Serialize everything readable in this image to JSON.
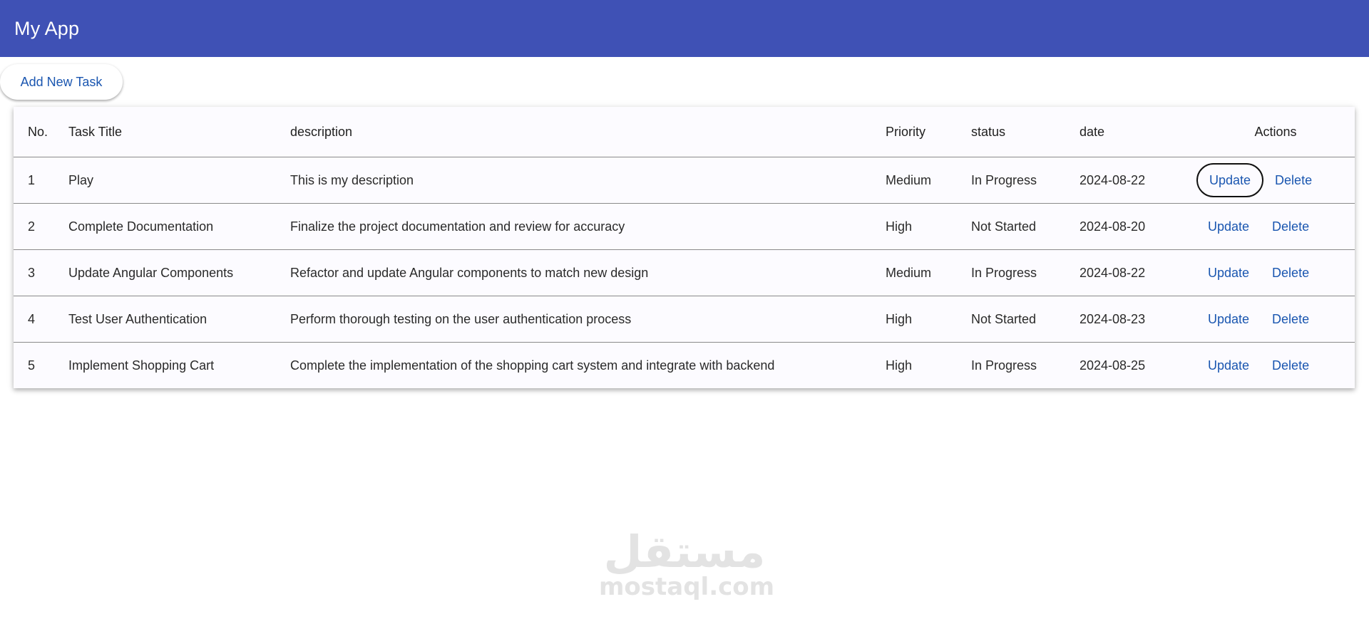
{
  "app": {
    "title": "My App"
  },
  "toolbar": {
    "add_label": "Add New Task"
  },
  "table": {
    "headers": {
      "no": "No.",
      "title": "Task Title",
      "description": "description",
      "priority": "Priority",
      "status": "status",
      "date": "date",
      "actions": "Actions"
    },
    "rows": [
      {
        "no": "1",
        "title": "Play",
        "description": "This is my description",
        "priority": "Medium",
        "status": "In Progress",
        "date": "2024-08-22",
        "update": "Update",
        "delete": "Delete"
      },
      {
        "no": "2",
        "title": "Complete Documentation",
        "description": "Finalize the project documentation and review for accuracy",
        "priority": "High",
        "status": "Not Started",
        "date": "2024-08-20",
        "update": "Update",
        "delete": "Delete"
      },
      {
        "no": "3",
        "title": "Update Angular Components",
        "description": "Refactor and update Angular components to match new design",
        "priority": "Medium",
        "status": "In Progress",
        "date": "2024-08-22",
        "update": "Update",
        "delete": "Delete"
      },
      {
        "no": "4",
        "title": "Test User Authentication",
        "description": "Perform thorough testing on the user authentication process",
        "priority": "High",
        "status": "Not Started",
        "date": "2024-08-23",
        "update": "Update",
        "delete": "Delete"
      },
      {
        "no": "5",
        "title": "Implement Shopping Cart",
        "description": "Complete the implementation of the shopping cart system and integrate with backend",
        "priority": "High",
        "status": "In Progress",
        "date": "2024-08-25",
        "update": "Update",
        "delete": "Delete"
      }
    ]
  },
  "watermark": {
    "arabic": "مستقل",
    "latin": "mostaql.com"
  },
  "colors": {
    "app_bar": "#3f51b5",
    "accent_text": "#1a56b0",
    "table_bg": "#fcfbff"
  }
}
